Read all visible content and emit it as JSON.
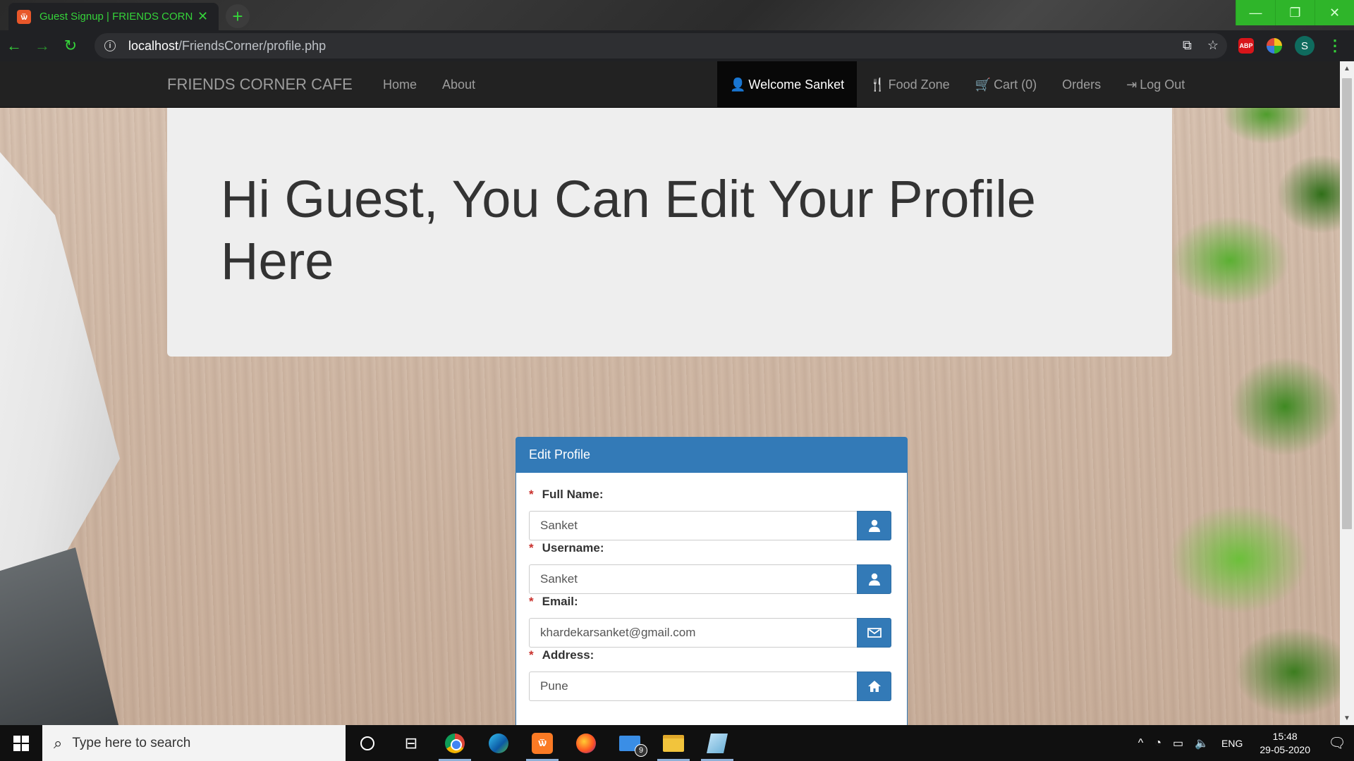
{
  "browser": {
    "tab_title": "Guest Signup | FRIENDS CORNER CAFE",
    "tab_favicon_text": "ѿ",
    "new_tab_label": "+",
    "url_host": "localhost",
    "url_path": "/FriendsCorner/profile.php",
    "profile_initial": "S",
    "abp_label": "ABP",
    "window_controls": [
      "—",
      "❐",
      "✕"
    ]
  },
  "site": {
    "brand": "FRIENDS CORNER CAFE",
    "nav_left": [
      "Home",
      "About"
    ],
    "nav_right": {
      "welcome": "Welcome Sanket",
      "food_zone": "Food Zone",
      "cart": "Cart (0)",
      "orders": "Orders",
      "logout": "Log Out"
    }
  },
  "jumbotron": {
    "title": "Hi Guest, You Can Edit Your Profile Here"
  },
  "edit_profile": {
    "heading": "Edit Profile",
    "required_marker": "*",
    "fields": [
      {
        "label": "Full Name:",
        "value": "Sanket",
        "icon": "user-icon"
      },
      {
        "label": "Username:",
        "value": "Sanket",
        "icon": "user-icon"
      },
      {
        "label": "Email:",
        "value": "khardekarsanket@gmail.com",
        "icon": "envelope-icon"
      },
      {
        "label": "Address:",
        "value": "Pune",
        "icon": "home-icon"
      }
    ]
  },
  "taskbar": {
    "search_placeholder": "Type here to search",
    "mail_badge": "9",
    "language": "ENG",
    "time": "15:48",
    "date": "29-05-2020"
  },
  "colors": {
    "accent_green": "#35d33a",
    "navbar_bg": "#222222",
    "panel_primary": "#337ab7",
    "jumbotron_bg": "#eeeeee"
  }
}
